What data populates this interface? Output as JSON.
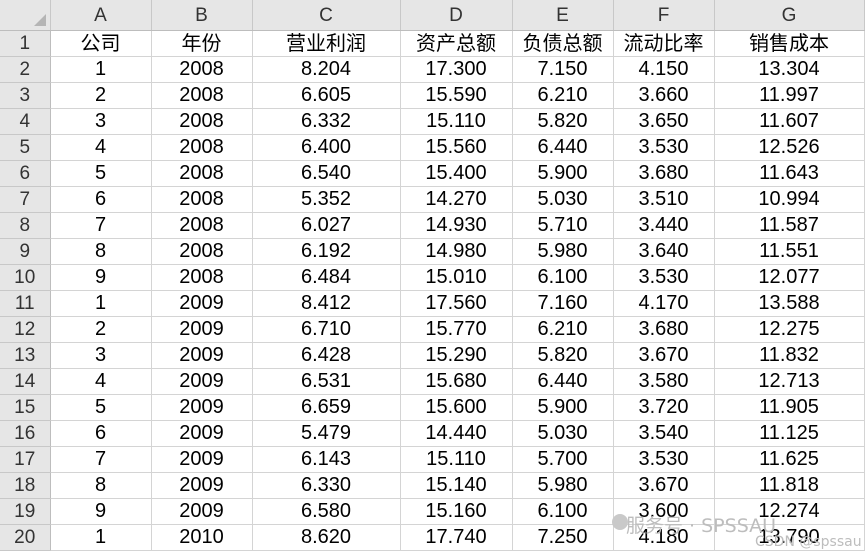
{
  "columns": [
    "A",
    "B",
    "C",
    "D",
    "E",
    "F",
    "G"
  ],
  "header_row": {
    "row": "1",
    "cells": [
      "公司",
      "年份",
      "营业利润",
      "资产总额",
      "负债总额",
      "流动比率",
      "销售成本"
    ]
  },
  "rows": [
    {
      "row": "2",
      "cells": [
        "1",
        "2008",
        "8.204",
        "17.300",
        "7.150",
        "4.150",
        "13.304"
      ]
    },
    {
      "row": "3",
      "cells": [
        "2",
        "2008",
        "6.605",
        "15.590",
        "6.210",
        "3.660",
        "11.997"
      ]
    },
    {
      "row": "4",
      "cells": [
        "3",
        "2008",
        "6.332",
        "15.110",
        "5.820",
        "3.650",
        "11.607"
      ]
    },
    {
      "row": "5",
      "cells": [
        "4",
        "2008",
        "6.400",
        "15.560",
        "6.440",
        "3.530",
        "12.526"
      ]
    },
    {
      "row": "6",
      "cells": [
        "5",
        "2008",
        "6.540",
        "15.400",
        "5.900",
        "3.680",
        "11.643"
      ]
    },
    {
      "row": "7",
      "cells": [
        "6",
        "2008",
        "5.352",
        "14.270",
        "5.030",
        "3.510",
        "10.994"
      ]
    },
    {
      "row": "8",
      "cells": [
        "7",
        "2008",
        "6.027",
        "14.930",
        "5.710",
        "3.440",
        "11.587"
      ]
    },
    {
      "row": "9",
      "cells": [
        "8",
        "2008",
        "6.192",
        "14.980",
        "5.980",
        "3.640",
        "11.551"
      ]
    },
    {
      "row": "10",
      "cells": [
        "9",
        "2008",
        "6.484",
        "15.010",
        "6.100",
        "3.530",
        "12.077"
      ]
    },
    {
      "row": "11",
      "cells": [
        "1",
        "2009",
        "8.412",
        "17.560",
        "7.160",
        "4.170",
        "13.588"
      ]
    },
    {
      "row": "12",
      "cells": [
        "2",
        "2009",
        "6.710",
        "15.770",
        "6.210",
        "3.680",
        "12.275"
      ]
    },
    {
      "row": "13",
      "cells": [
        "3",
        "2009",
        "6.428",
        "15.290",
        "5.820",
        "3.670",
        "11.832"
      ]
    },
    {
      "row": "14",
      "cells": [
        "4",
        "2009",
        "6.531",
        "15.680",
        "6.440",
        "3.580",
        "12.713"
      ]
    },
    {
      "row": "15",
      "cells": [
        "5",
        "2009",
        "6.659",
        "15.600",
        "5.900",
        "3.720",
        "11.905"
      ]
    },
    {
      "row": "16",
      "cells": [
        "6",
        "2009",
        "5.479",
        "14.440",
        "5.030",
        "3.540",
        "11.125"
      ]
    },
    {
      "row": "17",
      "cells": [
        "7",
        "2009",
        "6.143",
        "15.110",
        "5.700",
        "3.530",
        "11.625"
      ]
    },
    {
      "row": "18",
      "cells": [
        "8",
        "2009",
        "6.330",
        "15.140",
        "5.980",
        "3.670",
        "11.818"
      ]
    },
    {
      "row": "19",
      "cells": [
        "9",
        "2009",
        "6.580",
        "15.160",
        "6.100",
        "3.600",
        "12.274"
      ]
    },
    {
      "row": "20",
      "cells": [
        "1",
        "2010",
        "8.620",
        "17.740",
        "7.250",
        "4.180",
        "13.790"
      ]
    }
  ],
  "watermark": {
    "main": "服务号 · SPSSAU",
    "sub": "CSDN @spssau"
  },
  "colors": {
    "header_bg": "#e6e6e6",
    "gridline": "#d4d4d4",
    "text": "#000000"
  }
}
